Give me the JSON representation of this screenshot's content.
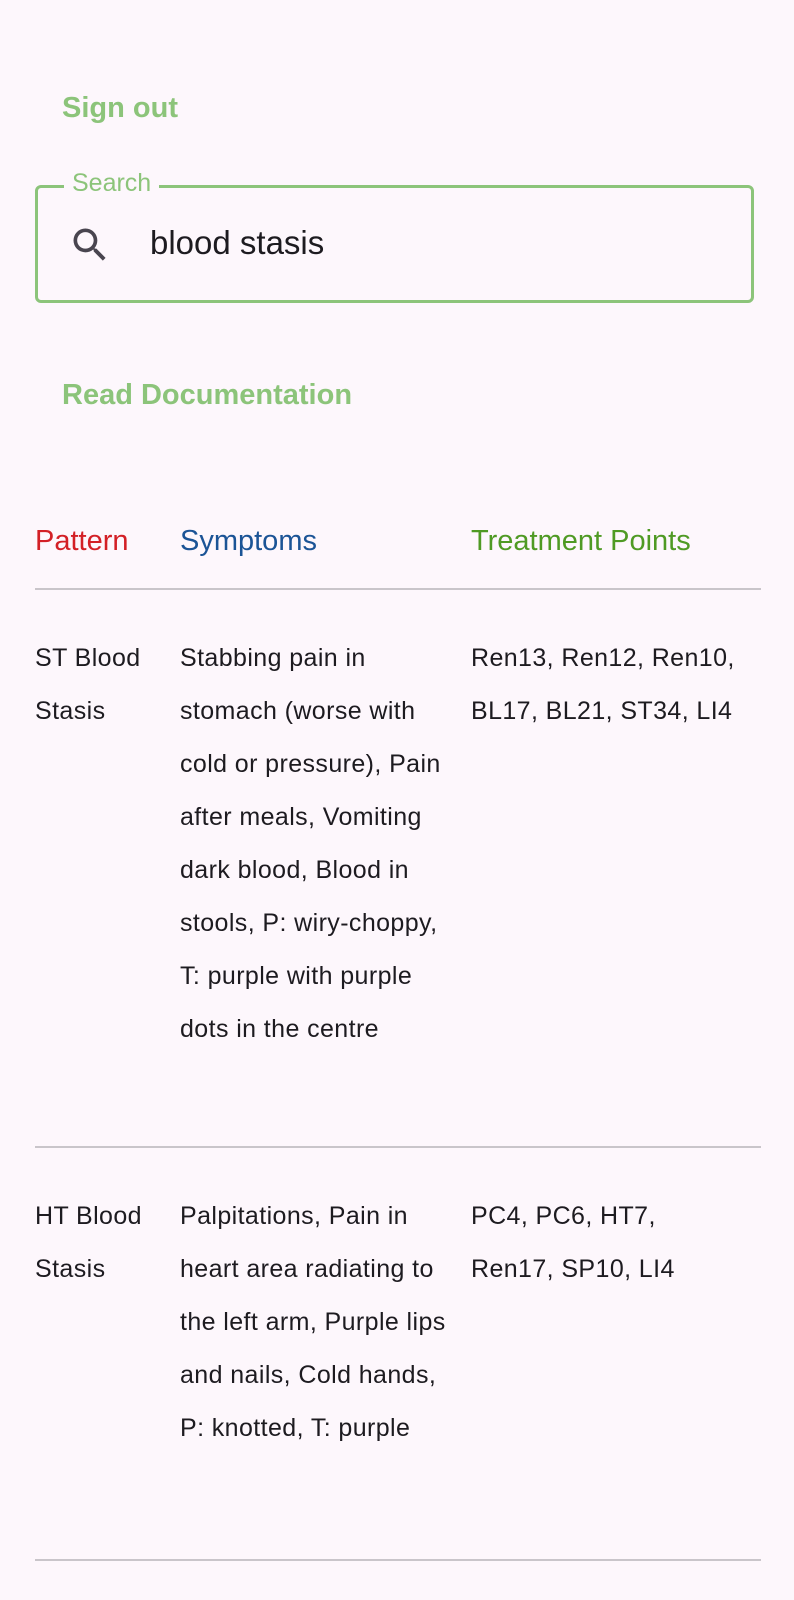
{
  "header": {
    "sign_out_label": "Sign out",
    "read_documentation_label": "Read Documentation"
  },
  "search": {
    "legend": "Search",
    "value": "blood stasis",
    "icon": "search-icon"
  },
  "colors": {
    "accent_green": "#8cc47a",
    "pattern_header": "#d32026",
    "symptoms_header": "#1b5496",
    "treatment_header": "#4f9a24",
    "background": "#fdf7fc"
  },
  "table": {
    "headers": {
      "pattern": "Pattern",
      "symptoms": "Symptoms",
      "treatment": "Treatment Points"
    },
    "rows": [
      {
        "pattern": "ST Blood Stasis",
        "symptoms": "Stabbing pain in stomach (worse with cold or pressure), Pain after meals, Vomiting dark blood, Blood in stools, P: wiry-choppy, T: purple with purple dots in the centre",
        "treatment": "Ren13, Ren12, Ren10, BL17, BL21, ST34, LI4"
      },
      {
        "pattern": "HT Blood Stasis",
        "symptoms": "Palpitations, Pain in heart area radiating to the left arm, Purple lips and nails, Cold hands, P: knotted, T: purple",
        "treatment": "PC4, PC6, HT7, Ren17, SP10, LI4"
      }
    ]
  }
}
